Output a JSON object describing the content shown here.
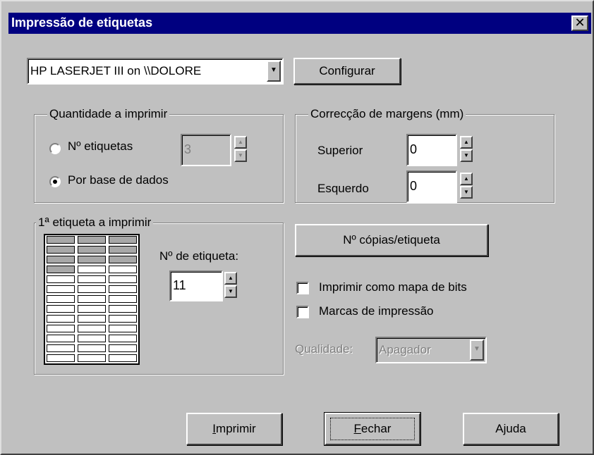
{
  "window": {
    "title": "Impressão de etiquetas",
    "close_glyph": "✕"
  },
  "printer": {
    "selected": "HP LASERJET III on \\\\DOLORE",
    "configure_label": "Configurar"
  },
  "quantity_group": {
    "title": "Quantidade a imprimir",
    "option_count_label": "Nº etiquetas",
    "count_value": "3",
    "option_database_label": "Por base de dados",
    "selected": "database"
  },
  "margins_group": {
    "title": "Correcção de margens (mm)",
    "top_label": "Superior",
    "top_value": "0",
    "left_label": "Esquerdo",
    "left_value": "0"
  },
  "first_label_group": {
    "title": "1ª etiqueta a imprimir",
    "label_number_label": "Nº de etiqueta:",
    "label_number_value": "11",
    "preview": {
      "rows": 13,
      "cols": 3,
      "highlighted_count": 10,
      "highlight_color": "#a8a8a8"
    }
  },
  "copies_button_label": "Nº cópias/etiqueta",
  "options": {
    "print_bitmap_label": "Imprimir como mapa de bits",
    "print_bitmap_checked": false,
    "print_marks_label": "Marcas de impressão",
    "print_marks_checked": false
  },
  "quality": {
    "label": "Qualidade:",
    "value": "Apagador",
    "enabled": false
  },
  "buttons": {
    "print_mnemonic": "I",
    "print_rest": "mprimir",
    "close_mnemonic": "F",
    "close_rest": "echar",
    "help_label": "Ajuda"
  },
  "icons": {
    "dropdown": "triangle-down-icon",
    "spin_up": "triangle-up-icon",
    "spin_down": "triangle-down-icon"
  }
}
